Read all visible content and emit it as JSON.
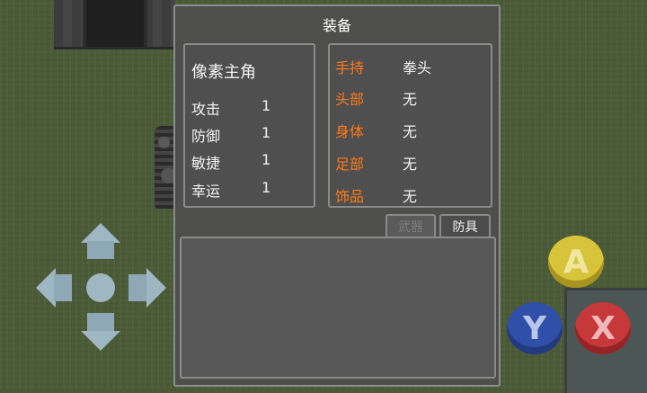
{
  "window": {
    "title": "装备"
  },
  "character": {
    "name": "像素主角",
    "stats": [
      {
        "label": "攻击",
        "value": "1"
      },
      {
        "label": "防御",
        "value": "1"
      },
      {
        "label": "敏捷",
        "value": "1"
      },
      {
        "label": "幸运",
        "value": "1"
      }
    ]
  },
  "equipment": {
    "slots": [
      {
        "label": "手持",
        "value": "拳头"
      },
      {
        "label": "头部",
        "value": "无"
      },
      {
        "label": "身体",
        "value": "无"
      },
      {
        "label": "足部",
        "value": "无"
      },
      {
        "label": "饰品",
        "value": "无"
      }
    ],
    "slot_label_color": "#ff7a1a"
  },
  "tabs": [
    {
      "label": "武器",
      "state": "disabled"
    },
    {
      "label": "防具",
      "state": "active"
    }
  ],
  "buttons": {
    "a": "A",
    "y": "Y",
    "x": "X"
  },
  "colors": {
    "grass": "#4b5b37",
    "window_bg": "#4e4e4e",
    "button_a": "#d8c43a",
    "button_y": "#2f4fa8",
    "button_x": "#c7383a",
    "dpad": "#9fb6c3"
  }
}
